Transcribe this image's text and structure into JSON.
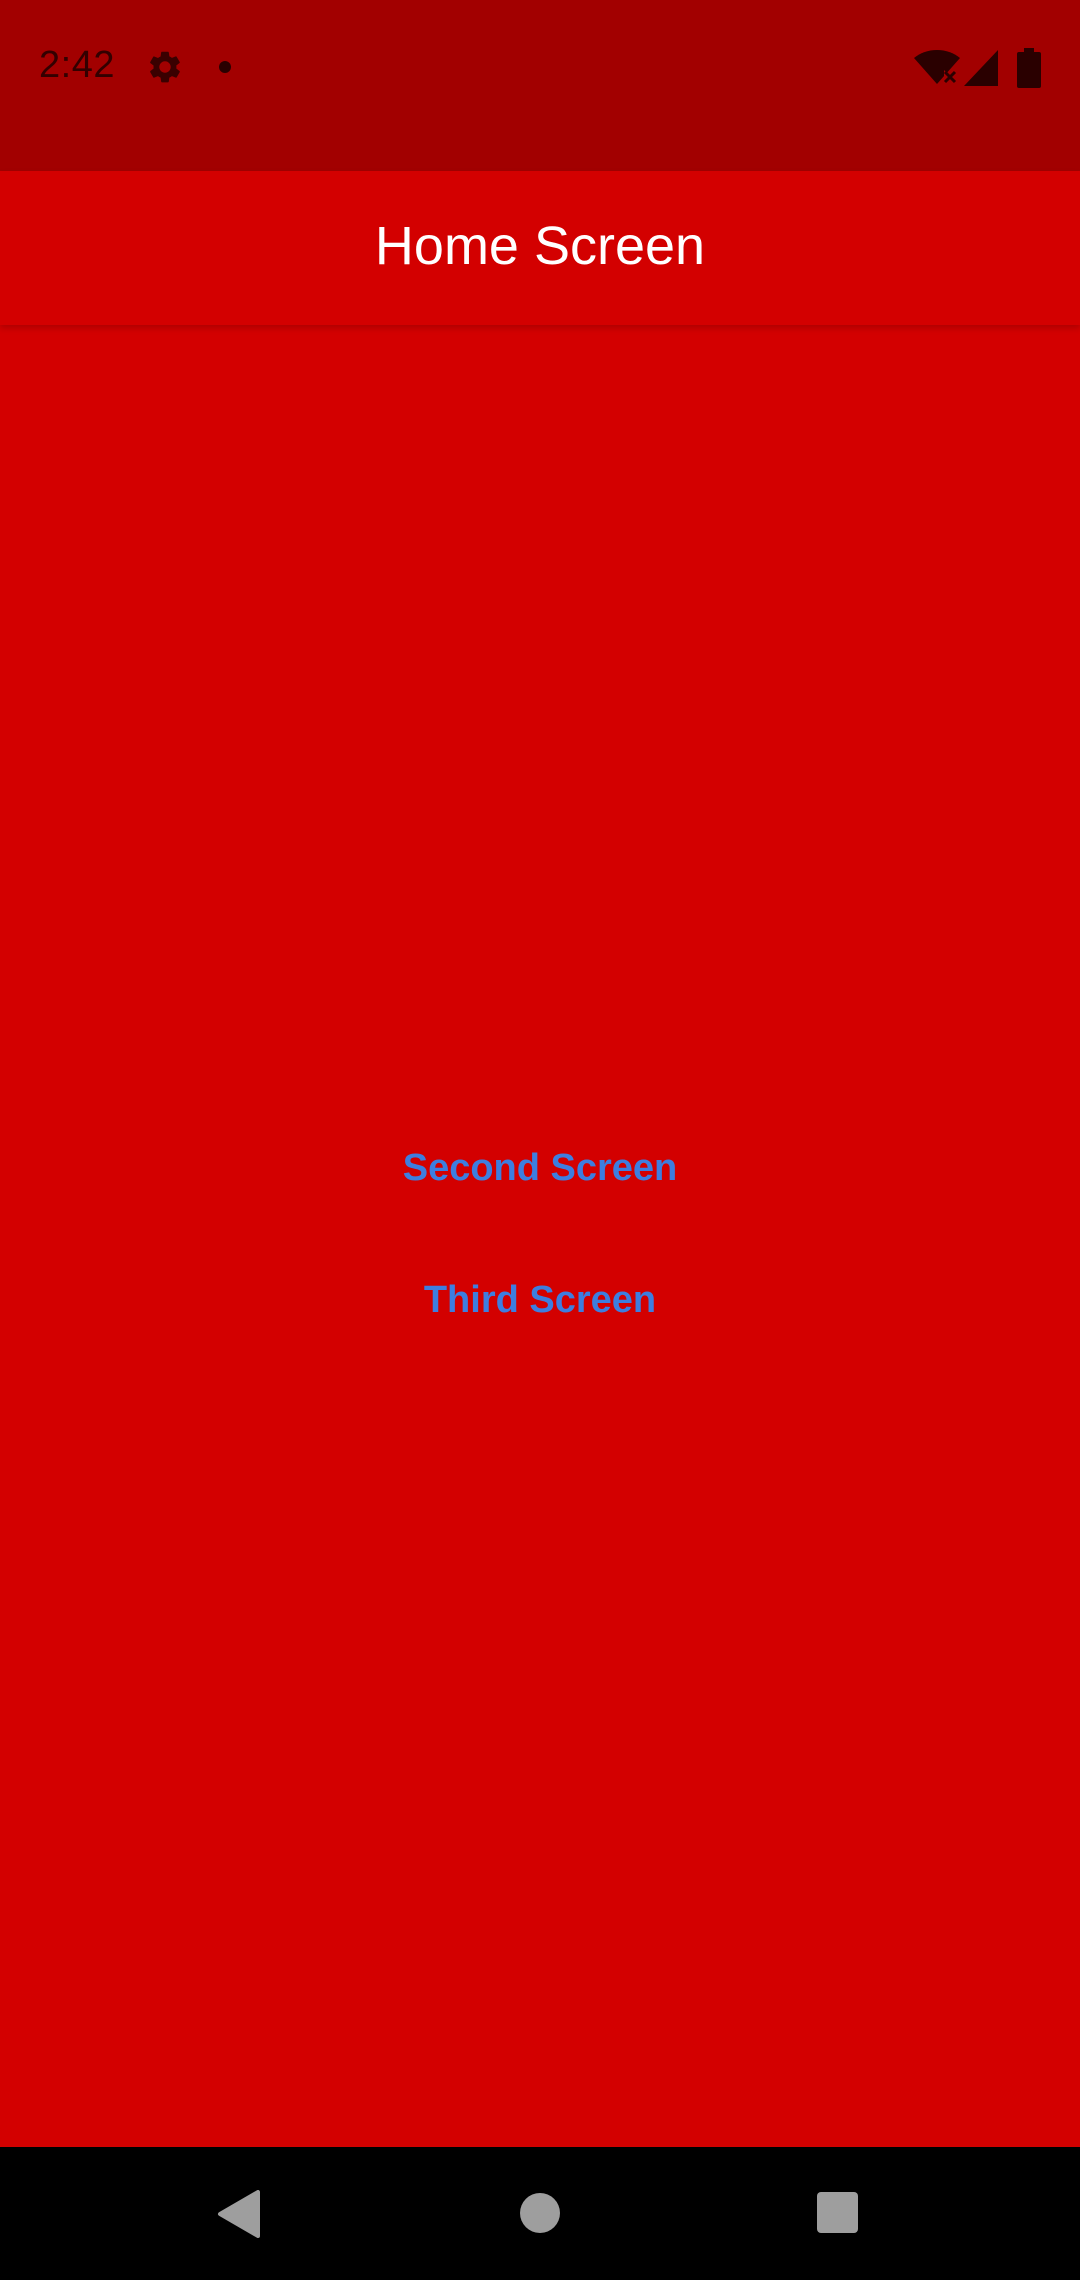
{
  "status_bar": {
    "time": "2:42",
    "icons": [
      "settings-gear-icon",
      "notification-dot-icon",
      "wifi-off-icon",
      "cell-signal-icon",
      "battery-icon"
    ]
  },
  "app_bar": {
    "title": "Home Screen"
  },
  "main": {
    "buttons": [
      {
        "label": "Second Screen"
      },
      {
        "label": "Third Screen"
      }
    ]
  },
  "nav_bar": {
    "icons": [
      "back-icon",
      "home-icon",
      "recents-icon"
    ]
  },
  "colors": {
    "background": "#d30000",
    "status_bar": "#a20000",
    "app_bar": "#d30000",
    "button_text": "#3d7ee0",
    "title_text": "#ffffff",
    "nav_bar": "#000000"
  }
}
